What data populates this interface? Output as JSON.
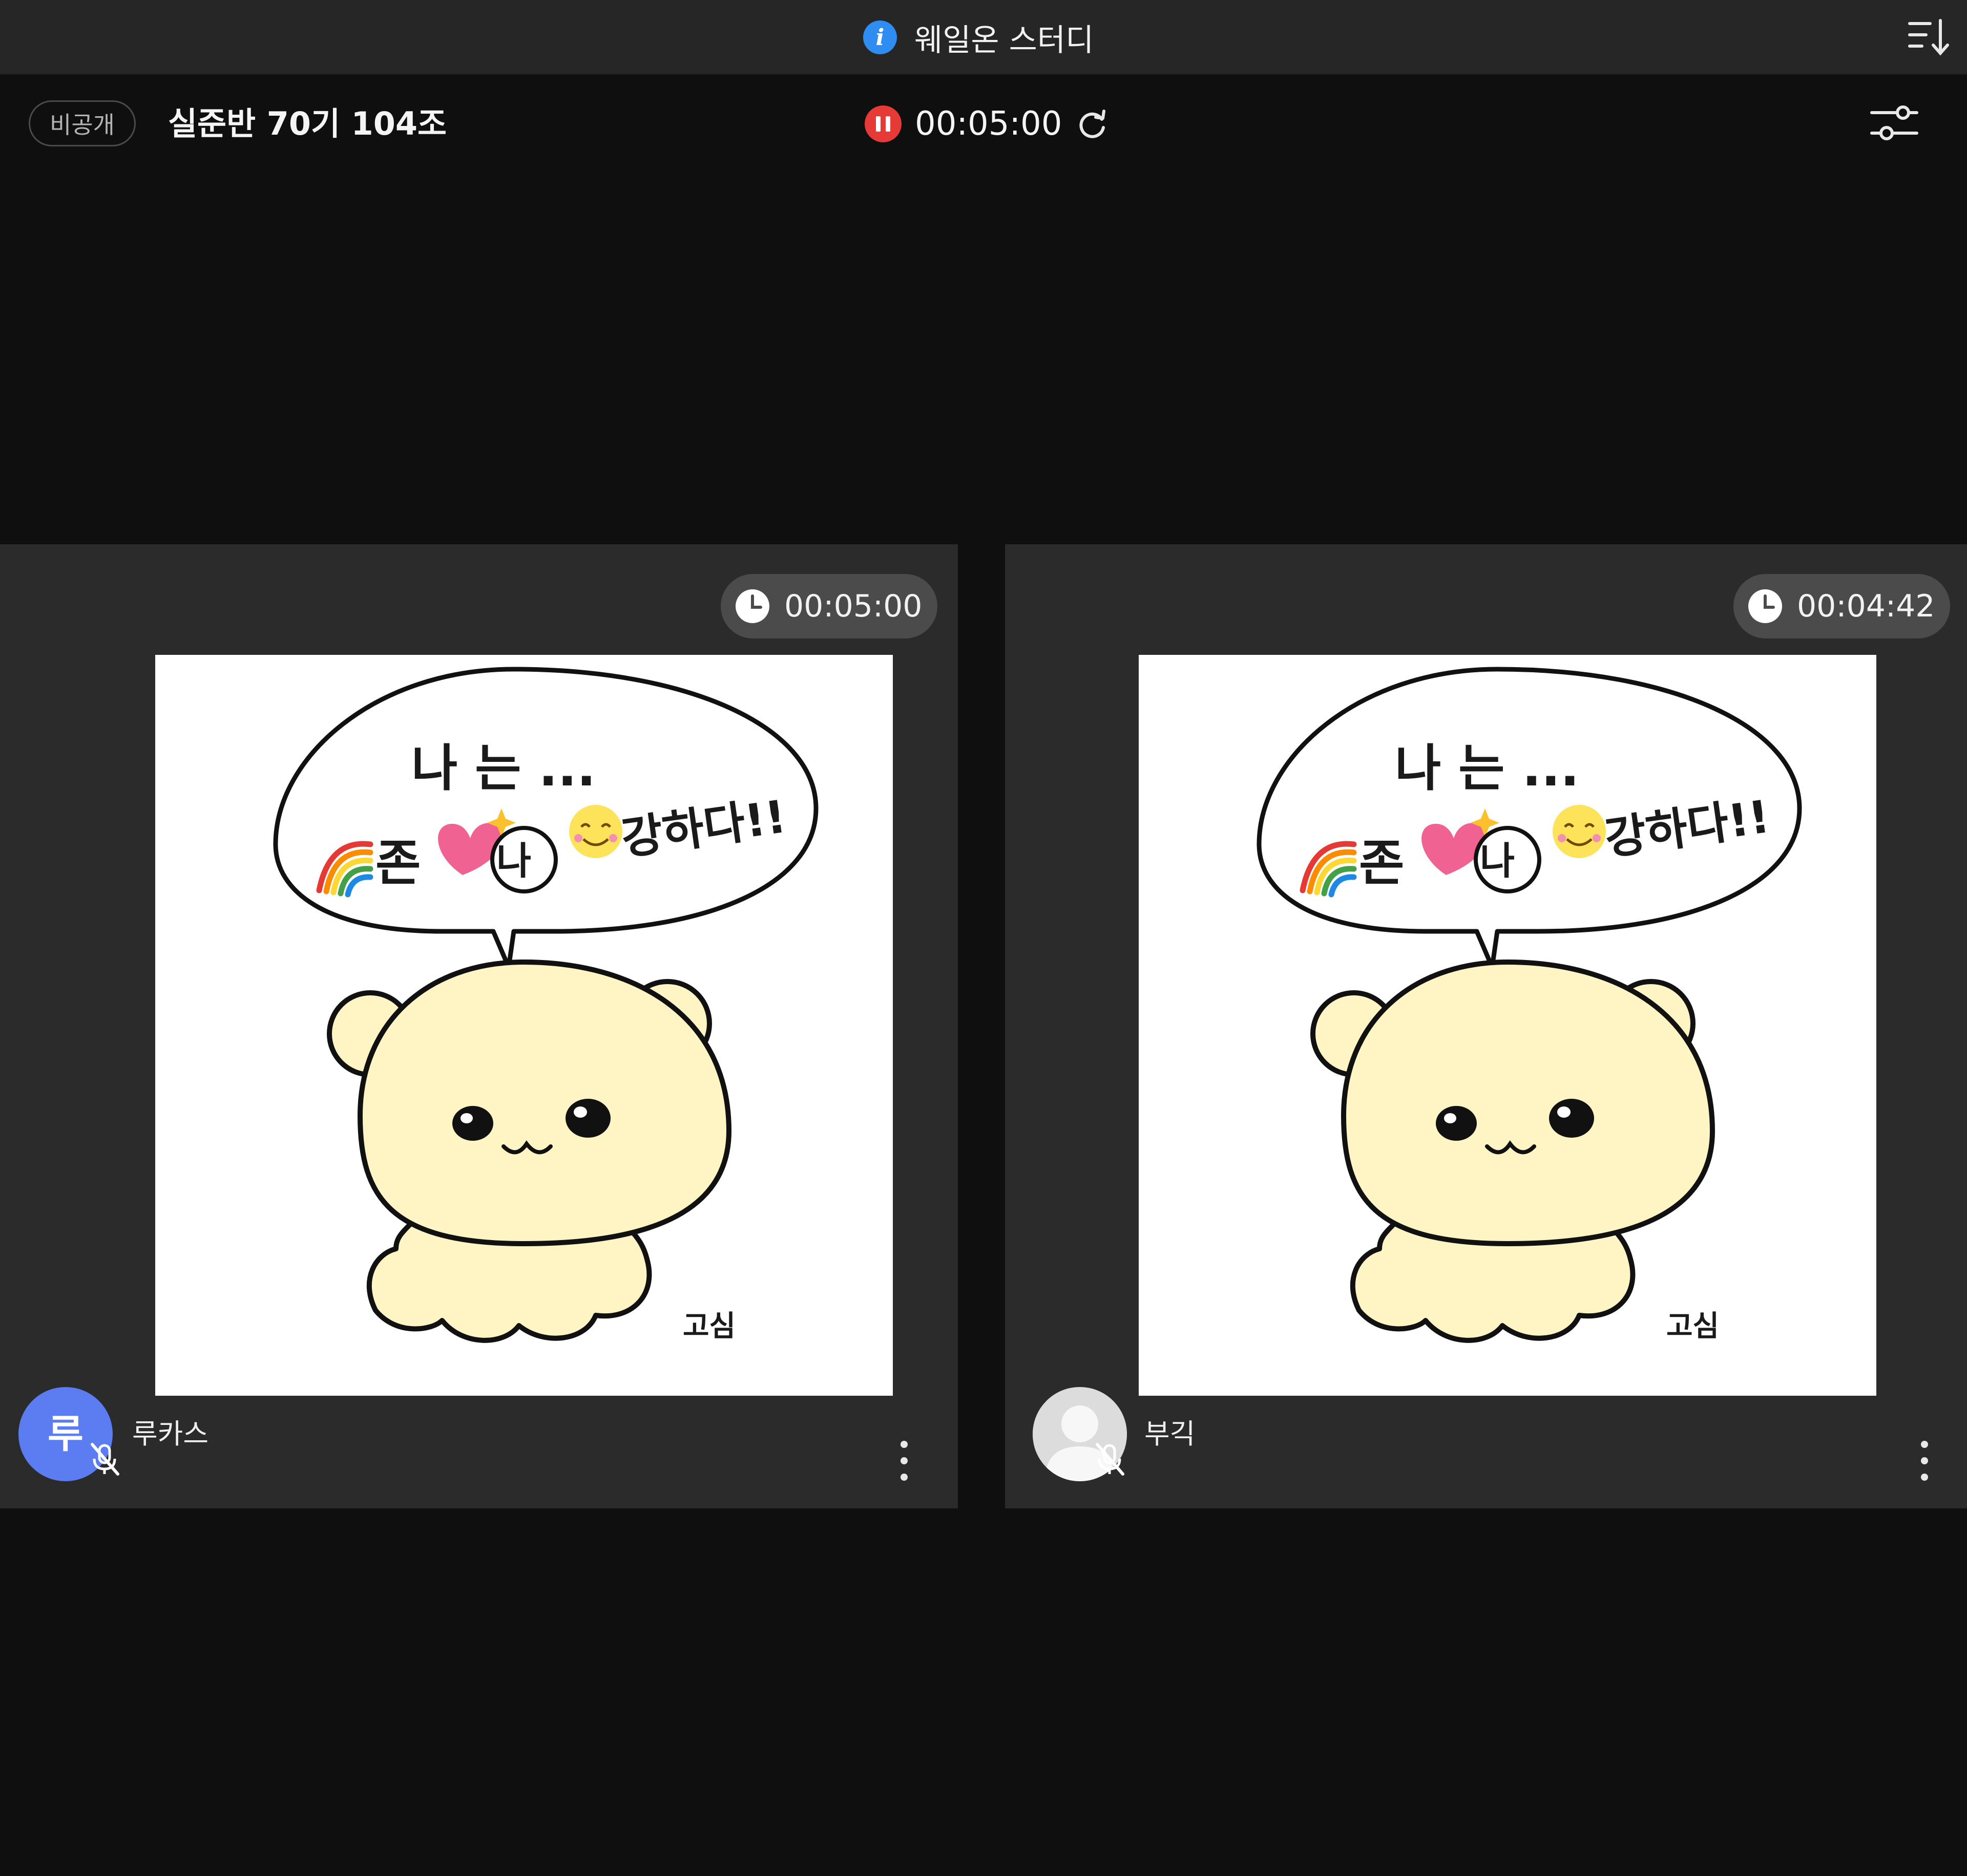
{
  "window": {
    "title": "웨일온 스터디",
    "title_icon": "info-icon",
    "sort_icon": "sort-descending-icon"
  },
  "room": {
    "visibility_badge": "비공개",
    "name": "실준반 70기 104조",
    "timer": "00:05:00",
    "timer_state_icon": "pause-icon",
    "reset_icon": "reset-icon",
    "settings_icon": "settings-sliders-icon"
  },
  "participants": [
    {
      "name": "루카스",
      "avatar_initial": "루",
      "avatar_color": "#5b7df1",
      "study_time": "00:05:00",
      "mic": "muted",
      "drawing_text": {
        "line1": "나 는 ...",
        "line2_a": "존",
        "line2_b": "나",
        "line2_c": "강하다!!",
        "signature": "고심"
      }
    },
    {
      "name": "부긱",
      "avatar_initial": "",
      "avatar_color": "#e3e3e3",
      "study_time": "00:04:42",
      "mic": "muted",
      "drawing_text": {
        "line1": "나 는 ...",
        "line2_a": "존",
        "line2_b": "나",
        "line2_c": "강하다!!",
        "signature": "고심"
      }
    }
  ],
  "colors": {
    "background": "#0f0f0f",
    "titlebar": "#262626",
    "tile": "#2b2b2b",
    "chip": "#4b4b4b",
    "pause_red": "#e63a36",
    "info_blue": "#2f8cf0",
    "bear_fill": "#fff5c4"
  }
}
